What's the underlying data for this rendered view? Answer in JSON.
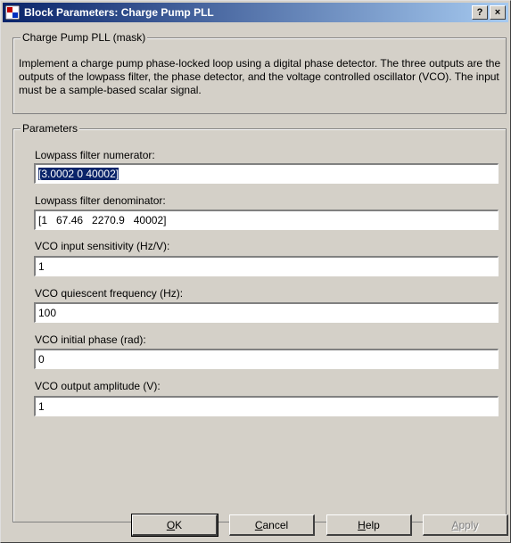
{
  "window": {
    "title": "Block Parameters: Charge Pump PLL",
    "help_glyph": "?",
    "close_glyph": "×",
    "icon": "simulink-block-icon"
  },
  "mask": {
    "legend": "Charge Pump PLL (mask)",
    "description": "Implement a charge pump phase-locked loop using a digital phase detector.  The three outputs are the outputs of the lowpass filter, the phase detector, and the voltage controlled oscillator (VCO).  The input must be a sample-based scalar signal."
  },
  "parameters": {
    "legend": "Parameters",
    "fields": [
      {
        "label": "Lowpass filter numerator:",
        "value": "[3.0002  0  40002]"
      },
      {
        "label": "Lowpass filter denominator:",
        "value": "[1   67.46   2270.9   40002]"
      },
      {
        "label": "VCO input sensitivity (Hz/V):",
        "value": "1"
      },
      {
        "label": "VCO quiescent frequency (Hz):",
        "value": "100"
      },
      {
        "label": "VCO initial phase (rad):",
        "value": "0"
      },
      {
        "label": "VCO output amplitude (V):",
        "value": "1"
      }
    ]
  },
  "buttons": {
    "ok": {
      "first": "O",
      "rest": "K"
    },
    "cancel": {
      "first": "C",
      "rest": "ancel"
    },
    "help": {
      "first": "H",
      "rest": "elp"
    },
    "apply": {
      "first": "A",
      "rest": "pply"
    }
  }
}
